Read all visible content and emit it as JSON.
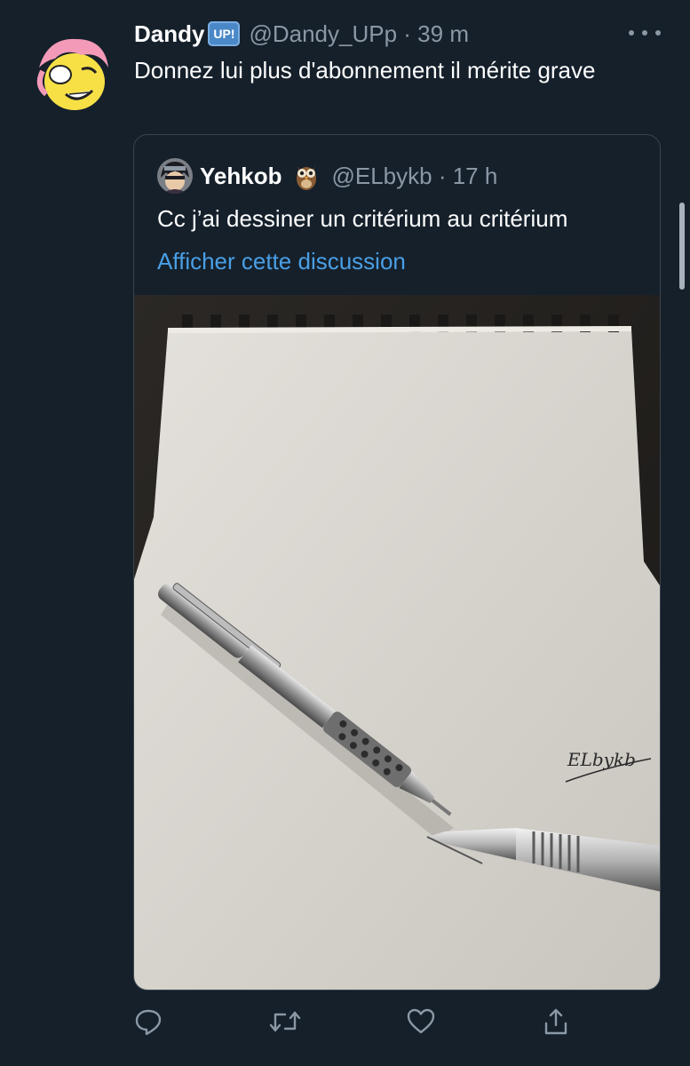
{
  "tweet": {
    "author": {
      "name": "Dandy",
      "badge": "UP!",
      "handle": "@Dandy_UPp",
      "time_sep": " · ",
      "time": "39 m"
    },
    "text": "Donnez lui plus d'abonnement il mérite grave",
    "more_icon": "ellipsis-icon"
  },
  "quoted": {
    "author": {
      "name": "Yehkob",
      "emoji": "owl",
      "handle": "@ELbykb",
      "time_sep": " · ",
      "time": "17 h"
    },
    "text": "Cc j’ai dessiner un critérium au critérium",
    "link": "Afficher cette discussion",
    "signature": "ELbykb"
  },
  "actions": [
    {
      "name": "reply",
      "icon": "reply-icon"
    },
    {
      "name": "retweet",
      "icon": "retweet-icon"
    },
    {
      "name": "like",
      "icon": "heart-icon"
    },
    {
      "name": "share",
      "icon": "share-icon"
    }
  ],
  "colors": {
    "background": "#15202b",
    "secondary_text": "#8b98a5",
    "link": "#4a9fe5",
    "border": "#38444d"
  }
}
